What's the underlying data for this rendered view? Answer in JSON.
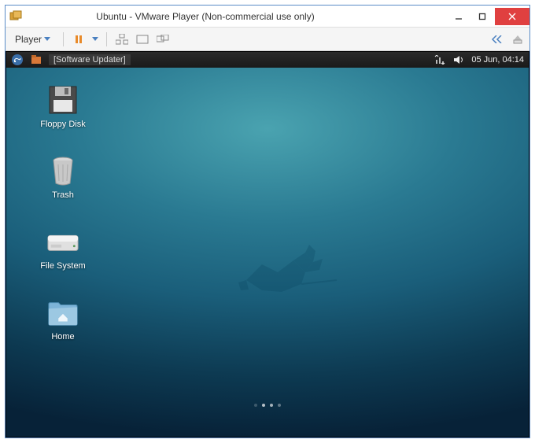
{
  "window": {
    "title": "Ubuntu - VMware Player (Non-commercial use only)"
  },
  "toolbar": {
    "player_label": "Player"
  },
  "panel": {
    "task_label": "[Software Updater]",
    "clock": "05 Jun, 04:14"
  },
  "desktop": {
    "floppy_label": "Floppy Disk",
    "trash_label": "Trash",
    "filesystem_label": "File System",
    "home_label": "Home"
  }
}
